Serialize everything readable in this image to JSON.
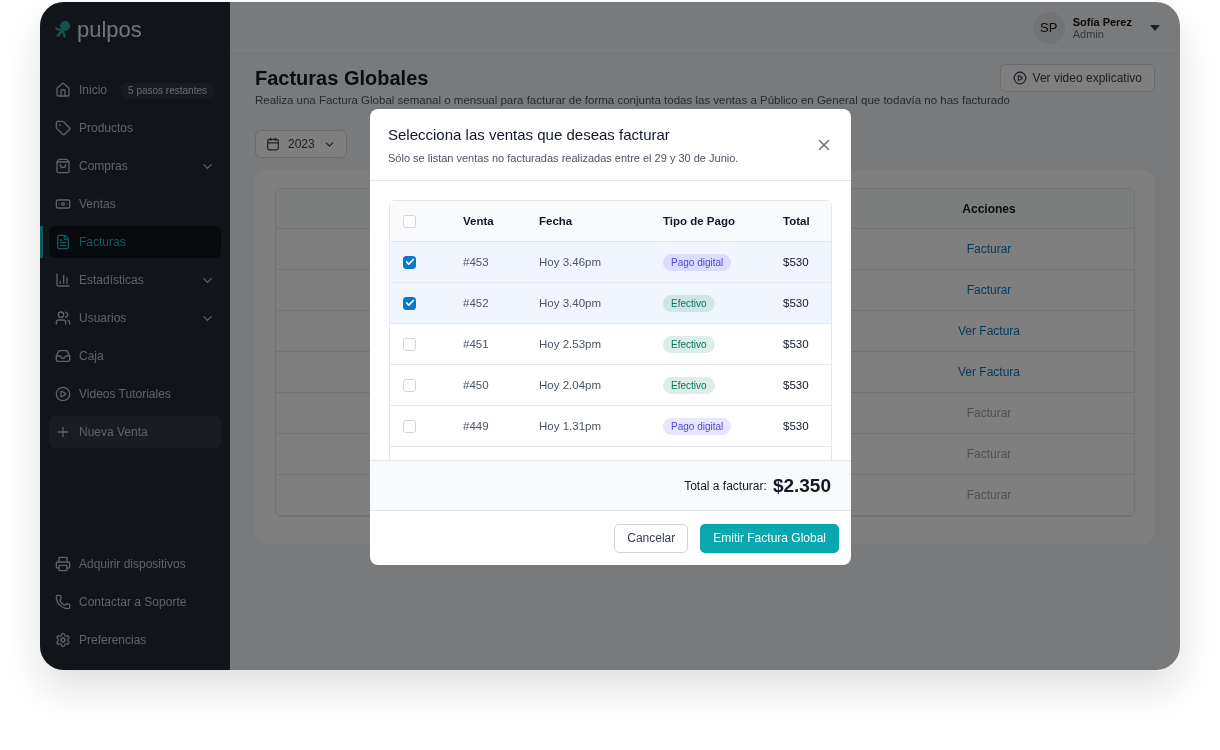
{
  "brand": {
    "name": "pulpos"
  },
  "sidebar": {
    "items": [
      {
        "label": "Inicio",
        "kind": "link",
        "selected": false,
        "badge": "5 pasos restantes"
      },
      {
        "label": "Productos",
        "kind": "link",
        "selected": false
      },
      {
        "label": "Compras",
        "kind": "group",
        "selected": false,
        "expanded": false
      },
      {
        "label": "Ventas",
        "kind": "link",
        "selected": false
      },
      {
        "label": "Facturas",
        "kind": "link",
        "selected": true
      },
      {
        "label": "Estadísticas",
        "kind": "group",
        "selected": false,
        "expanded": false
      },
      {
        "label": "Usuarios",
        "kind": "group",
        "selected": false,
        "expanded": false
      },
      {
        "label": "Caja",
        "kind": "link",
        "selected": false
      },
      {
        "label": "Videos Tutoriales",
        "kind": "link",
        "selected": false
      },
      {
        "label": "Nueva Venta",
        "kind": "action",
        "selected": false
      }
    ],
    "footer_items": [
      {
        "label": "Adquirir dispositivos"
      },
      {
        "label": "Contactar a Soporte"
      },
      {
        "label": "Preferencias"
      }
    ]
  },
  "user": {
    "initials": "SP",
    "name": "Sofía Perez",
    "role": "Admin"
  },
  "page": {
    "title": "Facturas Globales",
    "subtitle": "Realiza una Factura Global semanal o mensual para facturar de forma conjunta todas las ventas a Público en General que todavía no has facturado",
    "video_button": "Ver video explicativo",
    "year_filter": "2023"
  },
  "table": {
    "action_header": "Acciones",
    "rows": [
      {
        "action": "Facturar",
        "disabled": false
      },
      {
        "action": "Facturar",
        "disabled": false
      },
      {
        "action": "Ver Factura",
        "disabled": false
      },
      {
        "action": "Ver Factura",
        "disabled": false
      },
      {
        "action": "Facturar",
        "disabled": true
      },
      {
        "action": "Facturar",
        "disabled": true
      },
      {
        "action": "Facturar",
        "disabled": true
      }
    ]
  },
  "modal": {
    "title": "Selecciona las ventas que deseas facturar",
    "subtitle": "Sólo se listan ventas no facturadas realizadas entre el 29 y 30 de Junio.",
    "all_checked": false,
    "columns": [
      "Venta",
      "Fecha",
      "Tipo de Pago",
      "Total"
    ],
    "rows": [
      {
        "venta": "#453",
        "fecha": "Hoy 3.46pm",
        "pago": "Pago digital",
        "color": "#4f46e5",
        "total": "$530",
        "checked": true
      },
      {
        "venta": "#452",
        "fecha": "Hoy 3.40pm",
        "pago": "Efectivo",
        "color": "#047857",
        "total": "$530",
        "checked": true
      },
      {
        "venta": "#451",
        "fecha": "Hoy 2.53pm",
        "pago": "Efectivo",
        "color": "#047857",
        "total": "$530",
        "checked": false
      },
      {
        "venta": "#450",
        "fecha": "Hoy 2.04pm",
        "pago": "Efectivo",
        "color": "#047857",
        "total": "$530",
        "checked": false
      },
      {
        "venta": "#449",
        "fecha": "Hoy 1.31pm",
        "pago": "Pago digital",
        "color": "#4f46e5",
        "total": "$530",
        "checked": false
      }
    ],
    "total_label": "Total a facturar:",
    "total_value": "$2.350",
    "cancel": "Cancelar",
    "confirm": "Emitir Factura Global"
  }
}
